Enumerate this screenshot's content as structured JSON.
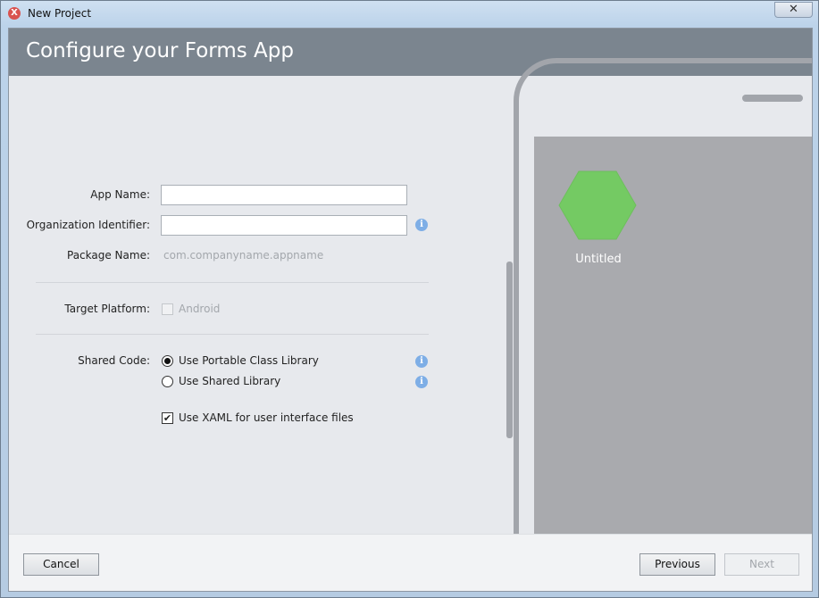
{
  "window": {
    "title": "New Project",
    "close_glyph": "✕",
    "icon": "xamarin-logo"
  },
  "header": {
    "title": "Configure your Forms App"
  },
  "form": {
    "app_name": {
      "label": "App Name:",
      "value": ""
    },
    "org_identifier": {
      "label": "Organization Identifier:",
      "value": ""
    },
    "package_name": {
      "label": "Package Name:",
      "value": "com.companyname.appname"
    },
    "target_platform": {
      "label": "Target Platform:",
      "option": "Android",
      "checked": false,
      "enabled": false
    },
    "shared_code": {
      "label": "Shared Code:",
      "options": [
        {
          "label": "Use Portable Class Library",
          "selected": true
        },
        {
          "label": "Use Shared Library",
          "selected": false
        }
      ]
    },
    "use_xaml": {
      "label": "Use XAML for user interface files",
      "checked": true
    },
    "info_glyph": "i"
  },
  "preview": {
    "app_label": "Untitled",
    "icon_color": "#74ca63"
  },
  "footer": {
    "cancel": "Cancel",
    "previous": "Previous",
    "next": "Next"
  }
}
